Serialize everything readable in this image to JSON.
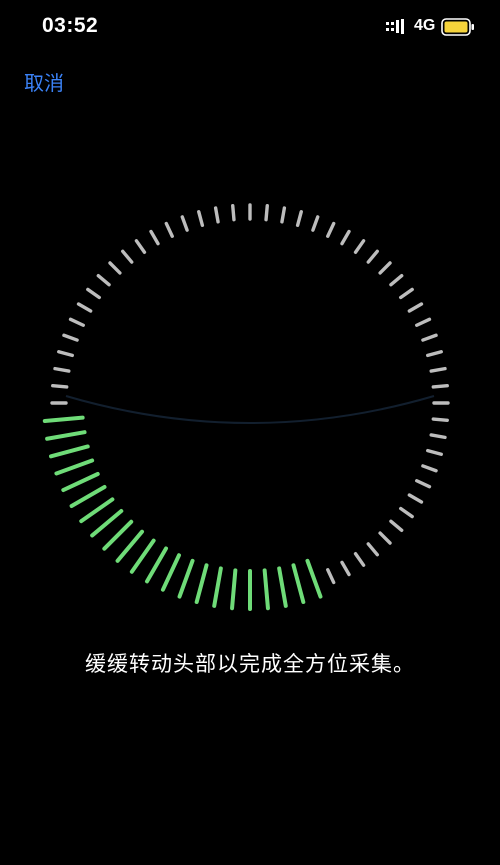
{
  "status_bar": {
    "time": "03:52",
    "network": "4G",
    "signal_icon": "cellular-signal-icon",
    "battery_icon": "battery-icon",
    "battery_color": "#f5d33b"
  },
  "nav": {
    "cancel_label": "取消",
    "cancel_color": "#3b82f6"
  },
  "scanner": {
    "progress": 0.3,
    "completed_color": "#6fdc78",
    "pending_color": "#bdbdbd"
  },
  "instruction": "缓缓转动头部以完成全方位采集。"
}
